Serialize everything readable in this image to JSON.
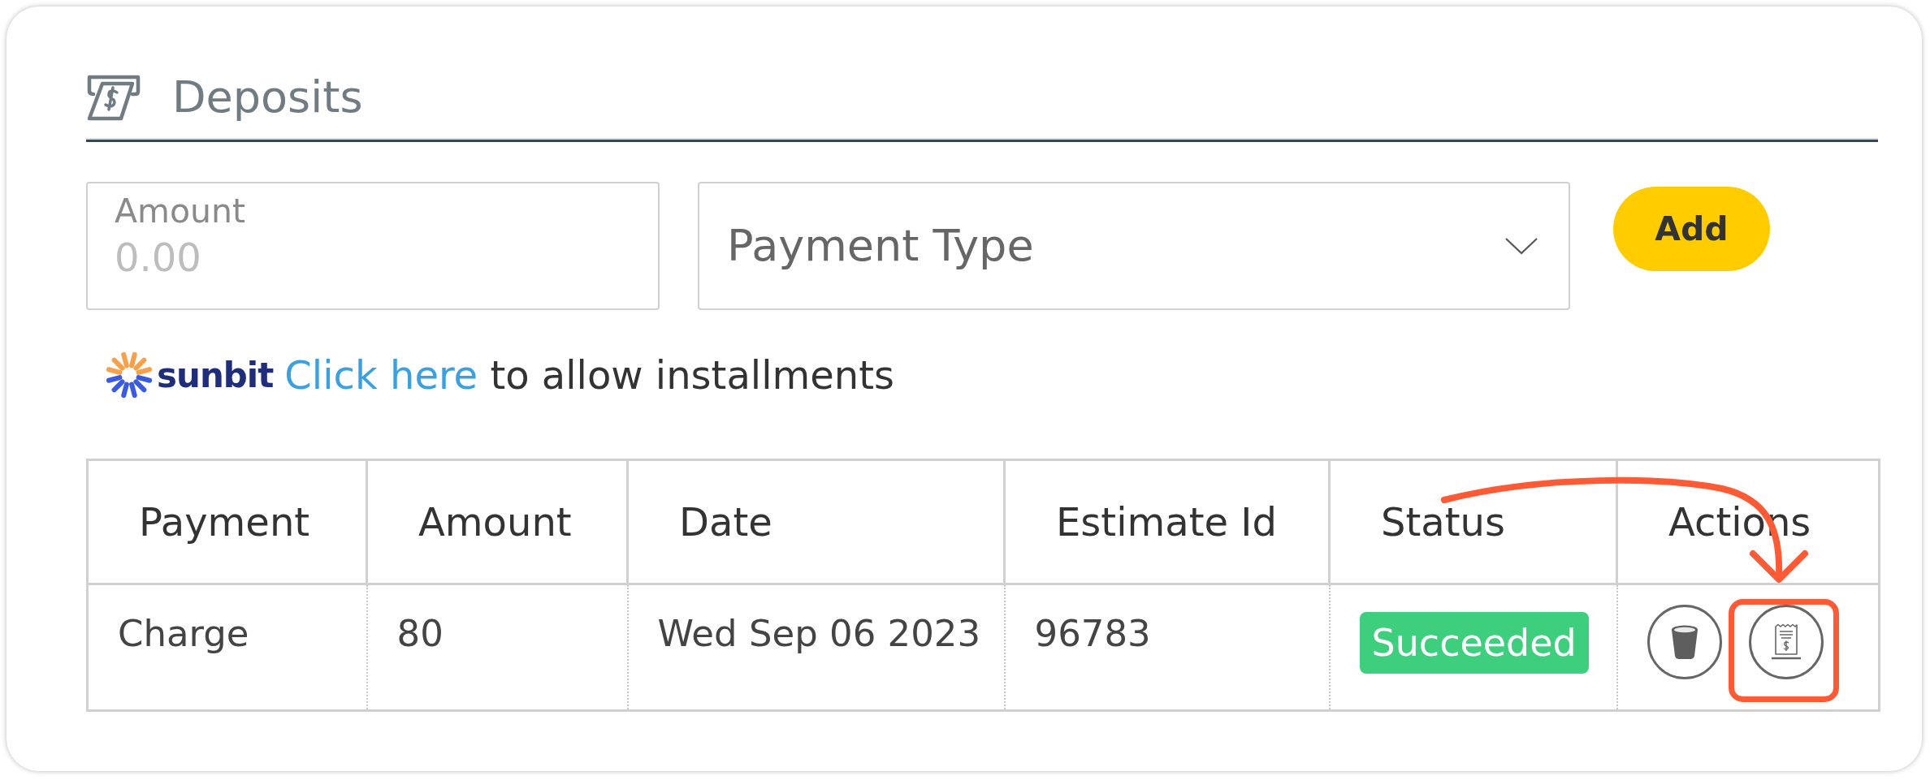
{
  "header": {
    "title": "Deposits"
  },
  "form": {
    "amount": {
      "label": "Amount",
      "placeholder": "0.00"
    },
    "payment_type": {
      "placeholder": "Payment Type"
    },
    "add_button": {
      "label": "Add"
    }
  },
  "installments": {
    "brand": "sunbit",
    "link": "Click here",
    "text": "to allow installments"
  },
  "table": {
    "columns": [
      "Payment",
      "Amount",
      "Date",
      "Estimate Id",
      "Status",
      "Actions"
    ],
    "rows": [
      {
        "cells": [
          "Charge",
          "80",
          "Wed Sep 06 2023",
          "96783"
        ],
        "status": {
          "label": "Succeeded",
          "color": "#3ecf7e"
        }
      }
    ]
  }
}
